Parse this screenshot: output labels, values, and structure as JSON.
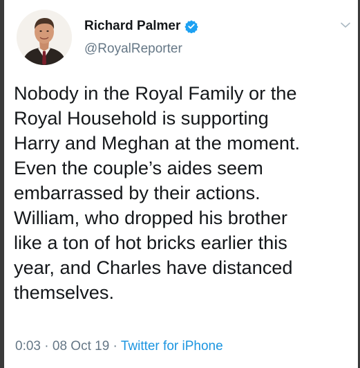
{
  "author": {
    "display_name": "Richard Palmer",
    "handle": "@RoyalReporter",
    "verified": true
  },
  "tweet": {
    "text": "Nobody in the Royal Family or the\nRoyal Household is supporting\nHarry and Meghan at the moment.\nEven the couple’s aides seem\nembarrassed by their actions.\nWilliam, who dropped his brother\nlike a ton of hot bricks earlier this\nyear, and Charles have distanced\nthemselves.",
    "time": "0:03",
    "separator": "·",
    "date": "08 Oct 19",
    "source": "Twitter for iPhone"
  },
  "colors": {
    "text": "#14171a",
    "secondary": "#657786",
    "link": "#1b95e0",
    "verified_badge": "#1da1f2"
  },
  "icons": {
    "verified": "verified-badge-icon",
    "menu": "chevron-down-icon"
  }
}
